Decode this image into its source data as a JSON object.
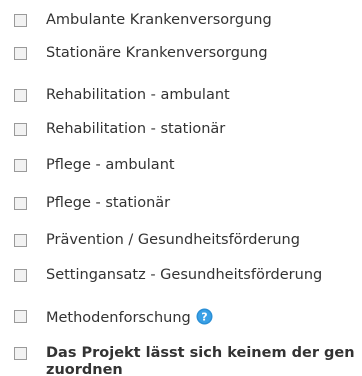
{
  "checkbox_list": {
    "items": [
      {
        "label": "Ambulante Krankenversorgung",
        "checked": false
      },
      {
        "label": "Stationäre Krankenversorgung",
        "checked": false
      },
      {
        "label": "Rehabilitation - ambulant",
        "checked": false
      },
      {
        "label": "Rehabilitation - stationär",
        "checked": false
      },
      {
        "label": "Pflege - ambulant",
        "checked": false
      },
      {
        "label": "Pflege - stationär",
        "checked": false
      },
      {
        "label": "Prävention / Gesundheitsförderung",
        "checked": false
      },
      {
        "label": "Settingansatz - Gesundheitsförderung",
        "checked": false
      },
      {
        "label": "Methodenforschung",
        "checked": false,
        "icon": "info-icon"
      },
      {
        "label": "Das Projekt lässt sich keinem der gen zuordnen",
        "checked": false
      }
    ]
  },
  "colors": {
    "text": "#333333",
    "checkbox_border": "#9a9a9a",
    "info_icon": "#2a8fd6"
  }
}
